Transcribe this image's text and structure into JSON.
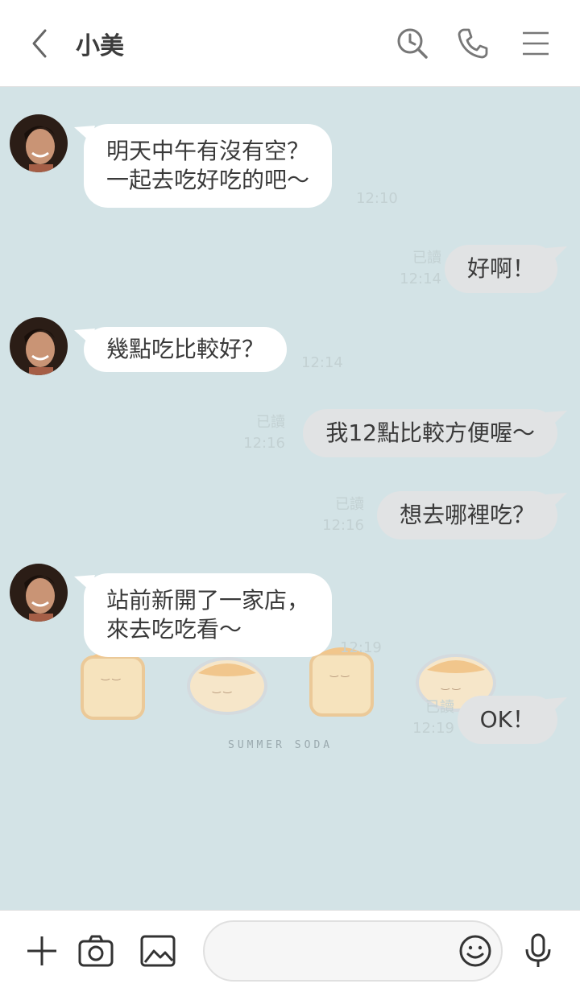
{
  "header": {
    "title": "小美",
    "icons": [
      "back-icon",
      "search-history-icon",
      "phone-icon",
      "menu-icon"
    ]
  },
  "messages": [
    {
      "side": "left",
      "lines": [
        "明天中午有沒有空？",
        "一起去吃好吃的吧～"
      ],
      "time": "12:10"
    },
    {
      "side": "right",
      "text": "好啊！",
      "read": "已讀",
      "time": "12:14"
    },
    {
      "side": "left",
      "text": "幾點吃比較好？",
      "time": "12:14"
    },
    {
      "side": "right",
      "text": "我12點比較方便喔～",
      "read": "已讀",
      "time": "12:16"
    },
    {
      "side": "right",
      "text": "想去哪裡吃？",
      "read": "已讀",
      "time": "12:16"
    },
    {
      "side": "left",
      "lines": [
        "站前新開了一家店，",
        "來去吃吃看～"
      ],
      "time": "12:19"
    },
    {
      "side": "right",
      "text": "OK！",
      "read": "已讀",
      "time": "12:19"
    }
  ],
  "decoration": {
    "text": "SUMMER SODA"
  },
  "input_bar": {
    "placeholder": "",
    "icons": [
      "plus-icon",
      "camera-icon",
      "image-icon",
      "emoji-icon",
      "mic-icon"
    ]
  },
  "colors": {
    "background": "#d3e3e6",
    "left_bubble": "#ffffff",
    "right_bubble": "#e1e3e4",
    "meta_text": "#c3d1d3"
  }
}
